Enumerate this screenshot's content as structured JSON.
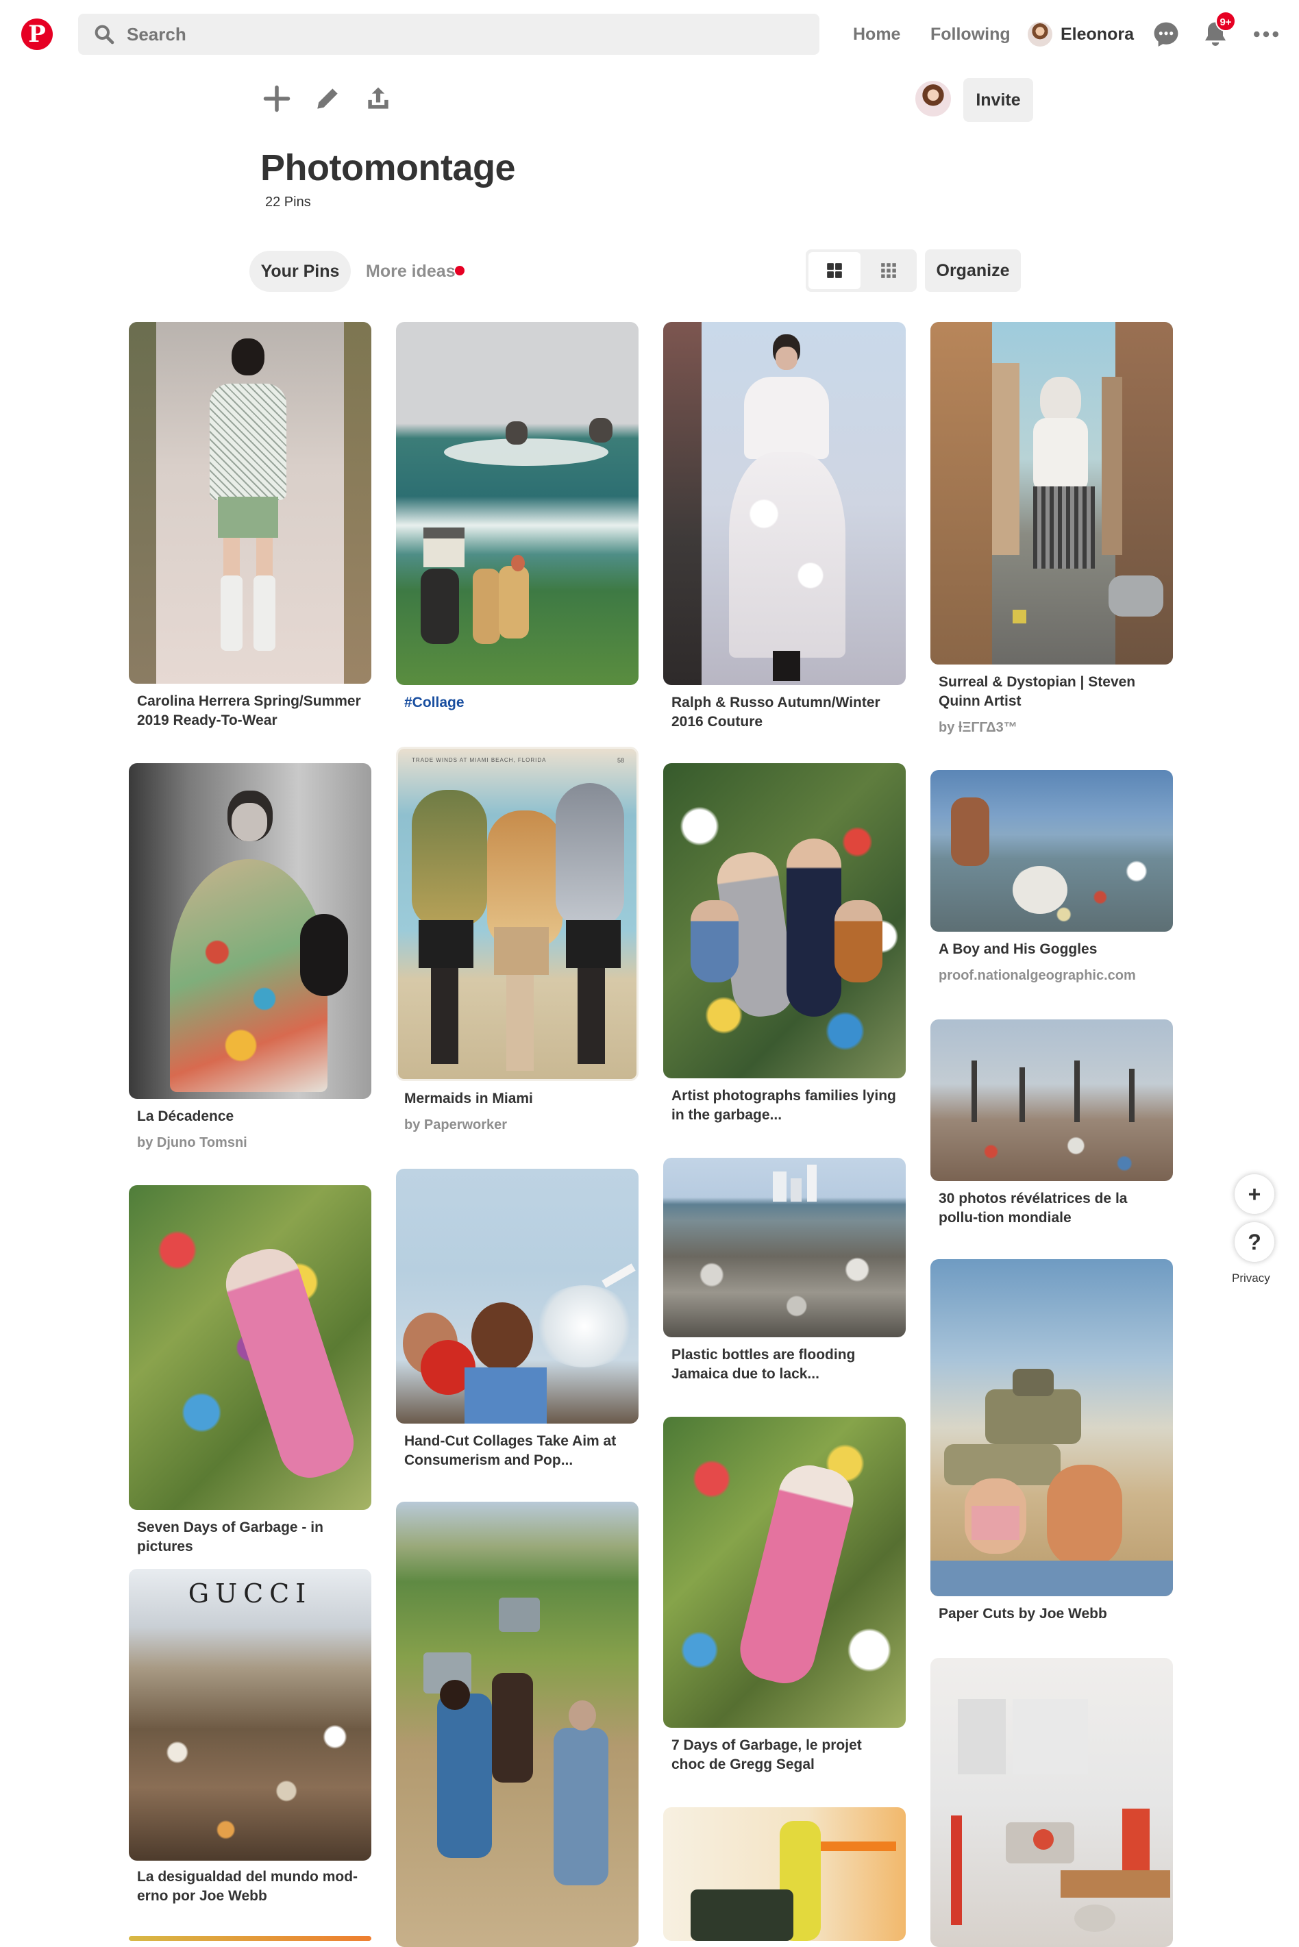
{
  "header": {
    "search_placeholder": "Search",
    "nav_home": "Home",
    "nav_following": "Following",
    "user_name": "Eleonora",
    "notifications_badge": "9+",
    "brand_color": "#e60023"
  },
  "board": {
    "title": "Photomontage",
    "pin_count": "22 Pins",
    "invite_label": "Invite",
    "tab_your_pins": "Your Pins",
    "tab_more_ideas": "More ideas",
    "organize_label": "Organize",
    "toolbar_icons": [
      "plus-icon",
      "pencil-icon",
      "share-icon"
    ]
  },
  "pins": [
    {
      "caption": "Carolina Herrera Spring/Summer 2019 Ready-To-Wear",
      "source": ""
    },
    {
      "caption": "#Collage",
      "source": ""
    },
    {
      "caption": "Ralph & Russo Autumn/Winter 2016 Couture",
      "source": ""
    },
    {
      "caption": "Surreal & Dystopian | Steven Quinn Artist",
      "source": "by ƚΞΓΓΔ3™"
    },
    {
      "caption": "La Décadence",
      "source": "by Djuno Tomsni"
    },
    {
      "caption": "Mermaids in Miami",
      "source": "by Paperworker"
    },
    {
      "caption": "Artist photographs families lying in the garbage...",
      "source": ""
    },
    {
      "caption": "A Boy and His Goggles",
      "source": "proof.nationalgeographic.com"
    },
    {
      "caption": "30 photos révélatrices de la pollu-tion mondiale",
      "source": ""
    },
    {
      "caption": "Seven Days of Garbage - in pictures",
      "source": ""
    },
    {
      "caption": "Hand-Cut Collages Take Aim at Consumerism and Pop...",
      "source": ""
    },
    {
      "caption": "Plastic bottles are flooding Jamaica due to lack...",
      "source": ""
    },
    {
      "caption": "La desigualdad del mundo mod-erno por Joe Webb",
      "source": ""
    },
    {
      "caption": "7 Days of Garbage, le projet choc de Gregg Segal",
      "source": ""
    },
    {
      "caption": "Paper Cuts by Joe Webb",
      "source": ""
    },
    {
      "caption": "",
      "source": ""
    },
    {
      "caption": "",
      "source": ""
    },
    {
      "caption": "",
      "source": ""
    }
  ],
  "image_text": {
    "gucci_title": "GUCCI",
    "postcard_header": "TRADE WINDS AT MIAMI BEACH, FLORIDA",
    "postcard_number": "58"
  },
  "floating": {
    "add_label": "+",
    "help_label": "?",
    "privacy_label": "Privacy"
  }
}
